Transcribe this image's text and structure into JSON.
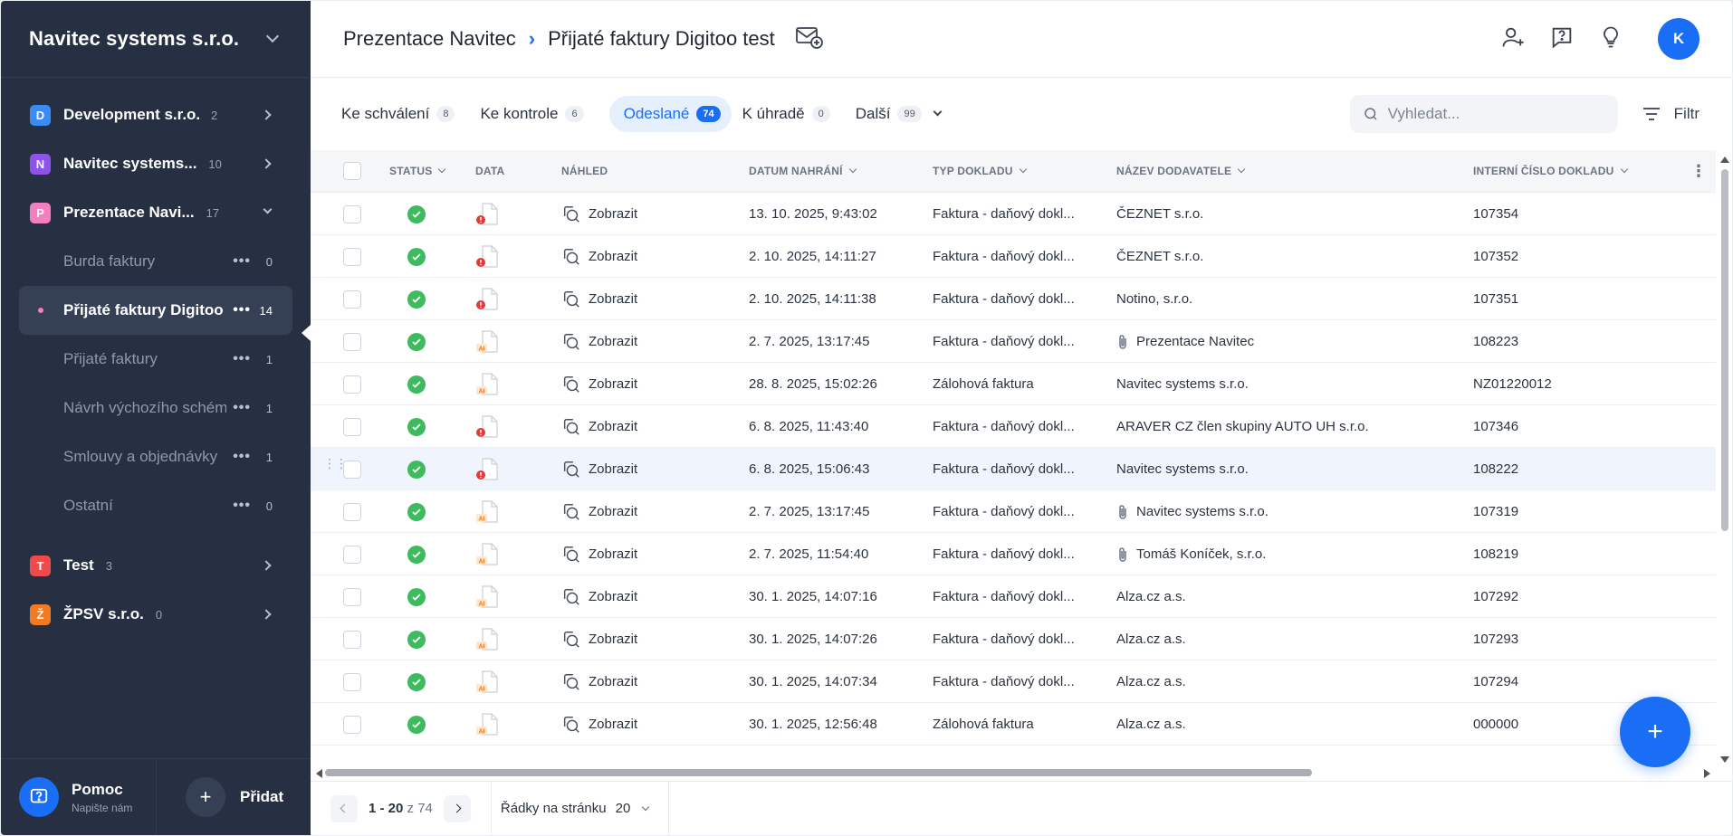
{
  "sidebar": {
    "org_name": "Navitec systems s.r.o.",
    "tree": [
      {
        "letter": "D",
        "label": "Development s.r.o.",
        "count": "2",
        "color": "#3b8cf2"
      },
      {
        "letter": "N",
        "label": "Navitec systems...",
        "count": "10",
        "color": "#8e54e9"
      },
      {
        "letter": "P",
        "label": "Prezentace Navi...",
        "count": "17",
        "color": "#f47fc0"
      }
    ],
    "subitems": [
      {
        "label": "Burda faktury",
        "count": "0"
      },
      {
        "label": "Přijaté faktury Digitoo test",
        "count": "14"
      },
      {
        "label": "Přijaté faktury",
        "count": "1"
      },
      {
        "label": "Návrh výchozího schéma",
        "count": "1"
      },
      {
        "label": "Smlouvy a objednávky",
        "count": "1"
      },
      {
        "label": "Ostatní",
        "count": "0"
      }
    ],
    "tree_bottom": [
      {
        "letter": "T",
        "label": "Test",
        "count": "3",
        "color": "#f04b4b"
      },
      {
        "letter": "Ž",
        "label": "ŽPSV s.r.o.",
        "count": "0",
        "color": "#f27a22"
      }
    ],
    "help_title": "Pomoc",
    "help_sub": "Napište nám",
    "add_label": "Přidat"
  },
  "header": {
    "crumb1": "Prezentace Navitec",
    "crumb2": "Přijaté faktury Digitoo test",
    "avatar": "K"
  },
  "tabs": [
    {
      "label": "Ke schválení",
      "count": "8"
    },
    {
      "label": "Ke kontrole",
      "count": "6"
    },
    {
      "label": "Odeslané",
      "count": "74"
    },
    {
      "label": "K úhradě",
      "count": "0"
    },
    {
      "label": "Další",
      "count": "99"
    }
  ],
  "search": {
    "placeholder": "Vyhledat..."
  },
  "filter_label": "Filtr",
  "table": {
    "columns": [
      "STATUS",
      "DATA",
      "NÁHLED",
      "DATUM NAHRÁNÍ",
      "TYP DOKLADU",
      "NÁZEV DODAVATELE",
      "INTERNÍ ČÍSLO DOKLADU"
    ],
    "preview_label": "Zobrazit",
    "rows": [
      {
        "data": "error",
        "date": "13. 10. 2025, 9:43:02",
        "type": "Faktura - daňový dokl...",
        "supplier": "ČEZNET s.r.o.",
        "clip": false,
        "num": "107354"
      },
      {
        "data": "error",
        "date": "2. 10. 2025, 14:11:27",
        "type": "Faktura - daňový dokl...",
        "supplier": "ČEZNET s.r.o.",
        "clip": false,
        "num": "107352"
      },
      {
        "data": "error",
        "date": "2. 10. 2025, 14:11:38",
        "type": "Faktura - daňový dokl...",
        "supplier": "Notino, s.r.o.",
        "clip": false,
        "num": "107351"
      },
      {
        "data": "ai",
        "date": "2. 7. 2025, 13:17:45",
        "type": "Faktura - daňový dokl...",
        "supplier": "Prezentace Navitec",
        "clip": true,
        "num": "108223"
      },
      {
        "data": "ai",
        "date": "28. 8. 2025, 15:02:26",
        "type": "Zálohová faktura",
        "supplier": "Navitec systems s.r.o.",
        "clip": false,
        "num": "NZ01220012"
      },
      {
        "data": "error",
        "date": "6. 8. 2025, 11:43:40",
        "type": "Faktura - daňový dokl...",
        "supplier": "ARAVER CZ člen skupiny AUTO UH s.r.o.",
        "clip": false,
        "num": "107346"
      },
      {
        "data": "error",
        "date": "6. 8. 2025, 15:06:43",
        "type": "Faktura - daňový dokl...",
        "supplier": "Navitec systems s.r.o.",
        "clip": false,
        "num": "108222"
      },
      {
        "data": "ai",
        "date": "2. 7. 2025, 13:17:45",
        "type": "Faktura - daňový dokl...",
        "supplier": "Navitec systems s.r.o.",
        "clip": true,
        "num": "107319"
      },
      {
        "data": "ai",
        "date": "2. 7. 2025, 11:54:40",
        "type": "Faktura - daňový dokl...",
        "supplier": "Tomáš Koníček, s.r.o.",
        "clip": true,
        "num": "108219"
      },
      {
        "data": "ai",
        "date": "30. 1. 2025, 14:07:16",
        "type": "Faktura - daňový dokl...",
        "supplier": "Alza.cz a.s.",
        "clip": false,
        "num": "107292"
      },
      {
        "data": "ai",
        "date": "30. 1. 2025, 14:07:26",
        "type": "Faktura - daňový dokl...",
        "supplier": "Alza.cz a.s.",
        "clip": false,
        "num": "107293"
      },
      {
        "data": "ai",
        "date": "30. 1. 2025, 14:07:34",
        "type": "Faktura - daňový dokl...",
        "supplier": "Alza.cz a.s.",
        "clip": false,
        "num": "107294"
      },
      {
        "data": "ai",
        "date": "30. 1. 2025, 12:56:48",
        "type": "Zálohová faktura",
        "supplier": "Alza.cz a.s.",
        "clip": false,
        "num": "000000"
      }
    ]
  },
  "pager": {
    "range": "1 - 20",
    "of": "z 74",
    "rows_label": "Řádky na stránku",
    "rows_value": "20"
  },
  "fab_label": "+"
}
